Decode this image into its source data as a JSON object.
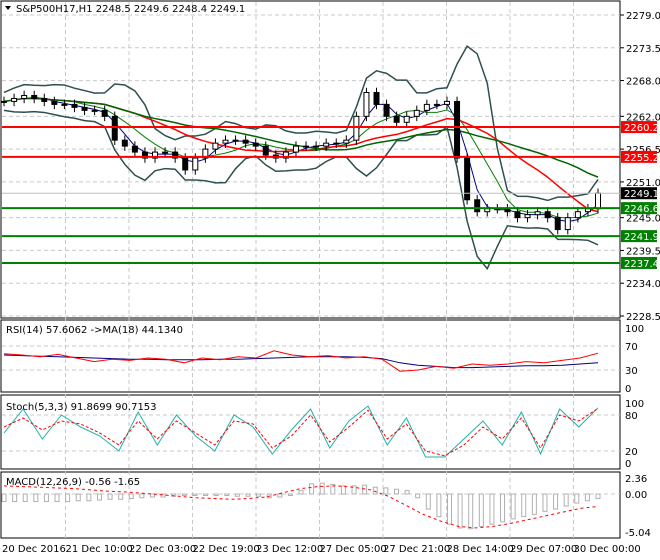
{
  "header": {
    "symbol_line": "S&P500H17,H1  2248.5 2249.6 2248.4 2249.1"
  },
  "chart_data": [
    {
      "type": "line",
      "name": "price",
      "title": "S&P500H17,H1",
      "ylim": [
        2228.5,
        2279.0
      ],
      "y_ticks": [
        "2279.0",
        "2273.5",
        "2268.0",
        "2262.0",
        "2256.5",
        "2251.0",
        "2245.0",
        "2239.5",
        "2234.0",
        "2228.5"
      ],
      "x_labels": [
        "20 Dec 2016",
        "21 Dec 10:00",
        "22 Dec 03:00",
        "22 Dec 19:00",
        "23 Dec 12:00",
        "27 Dec 05:00",
        "27 Dec 21:00",
        "28 Dec 14:00",
        "29 Dec 07:00",
        "30 Dec 00:00"
      ],
      "close": [
        2264.5,
        2265,
        2265.5,
        2265,
        2264.5,
        2264,
        2264,
        2263.5,
        2263,
        2263,
        2262,
        2258,
        2257,
        2256,
        2255,
        2256,
        2256,
        2255,
        2253,
        2255,
        2256.5,
        2257.5,
        2258,
        2258,
        2257.5,
        2257,
        2255.5,
        2255,
        2256,
        2257,
        2257,
        2257,
        2257.5,
        2257.5,
        2258,
        2262,
        2266,
        2264,
        2262,
        2261,
        2262,
        2263,
        2264,
        2264,
        2264.5,
        2255,
        2248,
        2246,
        2246.5,
        2246.5,
        2246,
        2245,
        2245.5,
        2246,
        2245,
        2243,
        2245,
        2246,
        2246.5,
        2249.1
      ],
      "current_price": "2249.1",
      "levels": [
        {
          "value": "2260.2",
          "color": "#ff0000"
        },
        {
          "value": "2255.2",
          "color": "#ff0000"
        },
        {
          "value": "2246.6",
          "color": "#008000"
        },
        {
          "value": "2241.9",
          "color": "#008000"
        },
        {
          "value": "2237.4",
          "color": "#008000"
        }
      ]
    },
    {
      "type": "line",
      "name": "rsi",
      "label": "RSI(14) 57.6062  ->MA(18) 44.1340",
      "ylim": [
        0,
        100
      ],
      "y_ticks": [
        "100",
        "70",
        "30",
        "0"
      ],
      "rsi": [
        57,
        55,
        52,
        56,
        50,
        44,
        48,
        46,
        50,
        48,
        42,
        50,
        47,
        52,
        50,
        62,
        55,
        52,
        54,
        50,
        52,
        48,
        28,
        30,
        36,
        33,
        40,
        38,
        40,
        44,
        42,
        46,
        50,
        58
      ],
      "ma": [
        55,
        54,
        53,
        52,
        51,
        50,
        49,
        48,
        48,
        47,
        47,
        47,
        48,
        48,
        49,
        50,
        51,
        52,
        52,
        52,
        51,
        49,
        42,
        38,
        36,
        34,
        34,
        35,
        36,
        37,
        37,
        38,
        40,
        42
      ]
    },
    {
      "type": "line",
      "name": "stoch",
      "label": "Stoch(5,3,3) 91.8699 90.7153",
      "ylim": [
        0,
        100
      ],
      "y_ticks": [
        "100",
        "80",
        "20",
        "0"
      ],
      "k": [
        50,
        90,
        40,
        80,
        60,
        45,
        20,
        85,
        30,
        80,
        45,
        20,
        80,
        60,
        15,
        55,
        90,
        25,
        70,
        95,
        30,
        75,
        10,
        10,
        40,
        70,
        30,
        85,
        15,
        90,
        60,
        92
      ],
      "d": [
        60,
        75,
        55,
        70,
        65,
        50,
        30,
        70,
        40,
        70,
        50,
        30,
        70,
        65,
        25,
        45,
        80,
        35,
        60,
        88,
        40,
        65,
        20,
        12,
        30,
        60,
        40,
        75,
        25,
        80,
        70,
        91
      ]
    },
    {
      "type": "bar",
      "name": "macd",
      "label": "MACD(12,26,9) -0.56 -1.65",
      "ylim": [
        -5.04,
        2.36
      ],
      "y_ticks": [
        "2.36",
        "0.00",
        "-5.04"
      ],
      "hist": [
        -1,
        -1,
        -1,
        -1,
        -1,
        -1,
        -1,
        -0.9,
        -0.9,
        -0.8,
        -0.7,
        -0.7,
        -0.6,
        -0.5,
        -0.4,
        -0.4,
        -0.3,
        -0.2,
        -0.2,
        -0.2,
        -0.2,
        -0.2,
        -0.3,
        -0.3,
        -0.3,
        -0.5,
        -0.4,
        -0.2,
        0.5,
        1.5,
        1.6,
        1.4,
        1.2,
        1.2,
        1.3,
        1.0,
        0.9,
        0.7,
        0.5,
        -0.5,
        -2,
        -3,
        -4,
        -4.5,
        -4.6,
        -4.3,
        -4,
        -3.7,
        -3.3,
        -3,
        -2.7,
        -2.3,
        -2,
        -1.6,
        -1.2,
        -0.9,
        -0.6
      ],
      "signal": [
        1.2,
        1.1,
        1.0,
        0.9,
        0.8,
        0.6,
        0.4,
        0.3,
        0.1,
        -0.1,
        -0.3,
        -0.5,
        -0.6,
        -0.7,
        -0.6,
        -0.4,
        0.2,
        0.8,
        1.1,
        1.2,
        1.0,
        0.6,
        -0.3,
        -1.5,
        -2.7,
        -3.6,
        -4.3,
        -4.5,
        -4.3,
        -3.9,
        -3.4,
        -2.9,
        -2.4,
        -1.9,
        -1.65
      ]
    }
  ]
}
